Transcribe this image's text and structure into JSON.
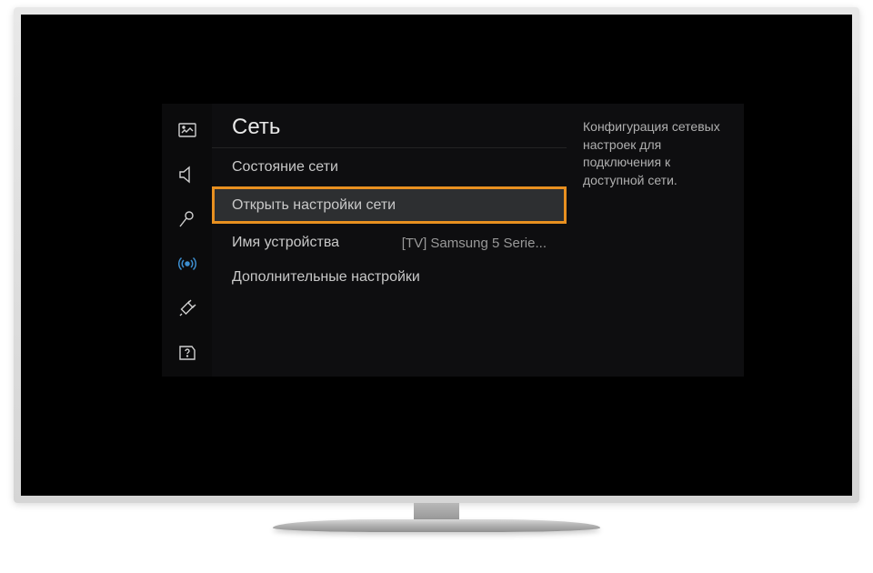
{
  "menu": {
    "title": "Сеть",
    "items": [
      {
        "label": "Состояние сети",
        "value": ""
      },
      {
        "label": "Открыть настройки сети",
        "value": ""
      },
      {
        "label": "Имя устройства",
        "value": "[TV] Samsung 5 Serie..."
      },
      {
        "label": "Дополнительные настройки",
        "value": ""
      }
    ],
    "description": "Конфигурация сетевых настроек для подключения к доступной сети."
  },
  "icons": {
    "picture": "picture-icon",
    "sound": "sound-icon",
    "broadcast": "broadcast-icon",
    "network": "network-icon",
    "system": "system-icon",
    "support": "support-icon"
  }
}
